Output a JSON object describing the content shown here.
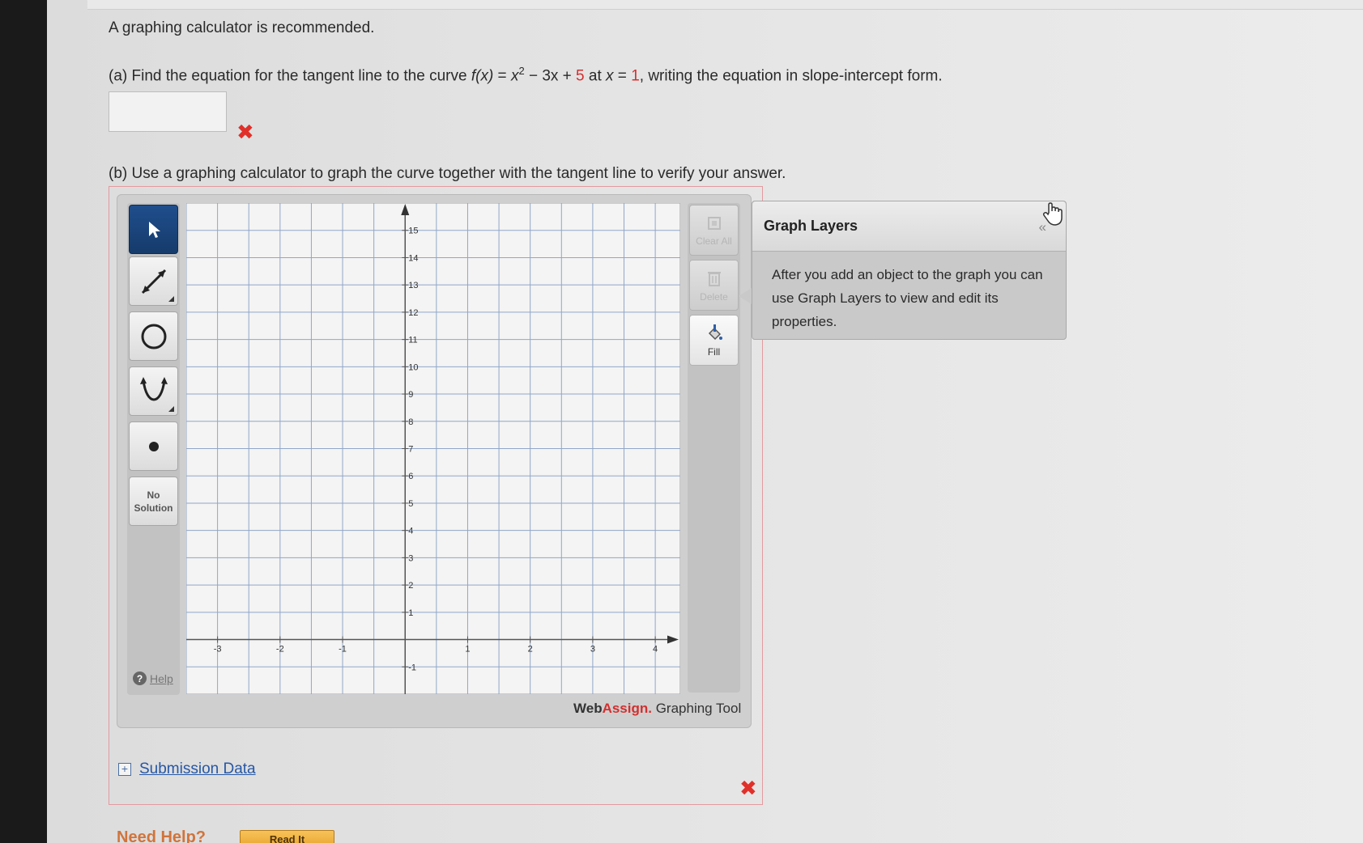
{
  "question": {
    "intro": "A graphing calculator is recommended.",
    "part_a": {
      "prefix": "(a) Find the equation for the tangent line to the curve",
      "fx": "f(x)",
      "eq": " = ",
      "x": "x",
      "exp": "2",
      "minus_3x": " − 3x + ",
      "c": "5",
      "at": " at ",
      "x2": "x",
      "eq2": " = ",
      "one": "1",
      "suffix": ", writing the equation in slope-intercept form.",
      "answer_value": "",
      "mark": "✖"
    },
    "part_b": {
      "text": "(b) Use a graphing calculator to graph the curve together with the tangent line to verify your answer.",
      "mark": "✖"
    }
  },
  "graph_tool": {
    "tools": [
      "select-tool",
      "line-tool",
      "circle-tool",
      "parabola-tool",
      "point-tool"
    ],
    "no_solution_label_1": "No",
    "no_solution_label_2": "Solution",
    "help_label": "Help",
    "right_buttons": {
      "clear_all": "Clear All",
      "delete": "Delete",
      "fill": "Fill"
    },
    "brand_web": "Web",
    "brand_assign": "Assign.",
    "brand_tool": " Graphing Tool",
    "x_ticks": [
      -3,
      -2,
      -1,
      1,
      2,
      3,
      4
    ],
    "y_ticks": [
      15,
      14,
      13,
      12,
      11,
      10,
      9,
      8,
      7,
      6,
      5,
      4,
      3,
      2,
      1,
      -1
    ],
    "x_range": [
      -3.5,
      4.4
    ],
    "y_range": [
      -2.0,
      16.0
    ]
  },
  "graph_layers": {
    "title": "Graph Layers",
    "collapse_glyph": "«",
    "body": "After you add an object to the graph you can use Graph Layers to view and edit its properties."
  },
  "submission": {
    "expand_glyph": "+",
    "link": "Submission Data"
  },
  "help_bar": {
    "need_help": "Need Help?",
    "read_it": "Read It"
  }
}
